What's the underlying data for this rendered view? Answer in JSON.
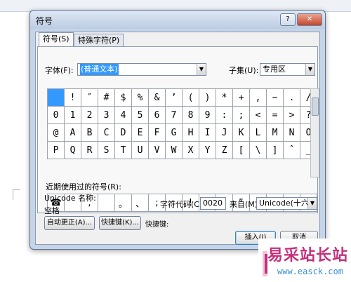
{
  "background": {
    "ribbon_items": [
      "",
      "",
      "",
      "",
      "",
      "",
      ""
    ]
  },
  "dialog": {
    "title": "符号",
    "help_label": "?",
    "close_label": "✕",
    "tabs": [
      {
        "label": "符号(S)",
        "active": true
      },
      {
        "label": "特殊字符(P)",
        "active": false
      }
    ],
    "font_label": "字体(F):",
    "font_value": "(普通文本)",
    "subset_label": "子集(U):",
    "subset_value": "专用区",
    "symbol_grid": [
      [
        " ",
        "!",
        "″",
        "#",
        "$",
        "%",
        "&",
        "’",
        "(",
        ")",
        "*",
        "+",
        ",",
        "−",
        ".",
        "/"
      ],
      [
        "0",
        "1",
        "2",
        "3",
        "4",
        "5",
        "6",
        "7",
        "8",
        "9",
        ":",
        ";",
        "<",
        "=",
        ">",
        "?"
      ],
      [
        "@",
        "A",
        "B",
        "C",
        "D",
        "E",
        "F",
        "G",
        "H",
        "I",
        "J",
        "K",
        "L",
        "M",
        "N",
        "O"
      ],
      [
        "P",
        "Q",
        "R",
        "S",
        "T",
        "U",
        "V",
        "W",
        "X",
        "Y",
        "Z",
        "[",
        "\\",
        "]",
        "ˆ",
        "_"
      ]
    ],
    "recent_label": "近期使用过的符号(R):",
    "recent_symbols": [
      "☎",
      "",
      ",",
      "",
      "。",
      "、",
      ";",
      ":",
      "!",
      "?",
      "“",
      "”",
      "(",
      "【",
      ")",
      "%"
    ],
    "unicode_name_label": "Unicode 名称:",
    "unicode_name_value": "空格",
    "char_code_label": "字符代码(C):",
    "char_code_value": "0020",
    "from_label": "来自(M):",
    "from_value": "Unicode(十六进",
    "autocorrect_button": "自动更正(A)...",
    "shortcut_button": "快捷键(K)...",
    "shortcut_label": "快捷键:",
    "insert_button": "插入(I)",
    "cancel_button": "取消"
  },
  "watermark": {
    "text": "易采站长站",
    "url": "www.easck.com"
  },
  "colors": {
    "selection": "#3399ff",
    "dialog_frame": "#c6d4e8",
    "close_button": "#c5452b",
    "watermark_text": "#c4307c",
    "watermark_url": "#3b8fd3"
  }
}
